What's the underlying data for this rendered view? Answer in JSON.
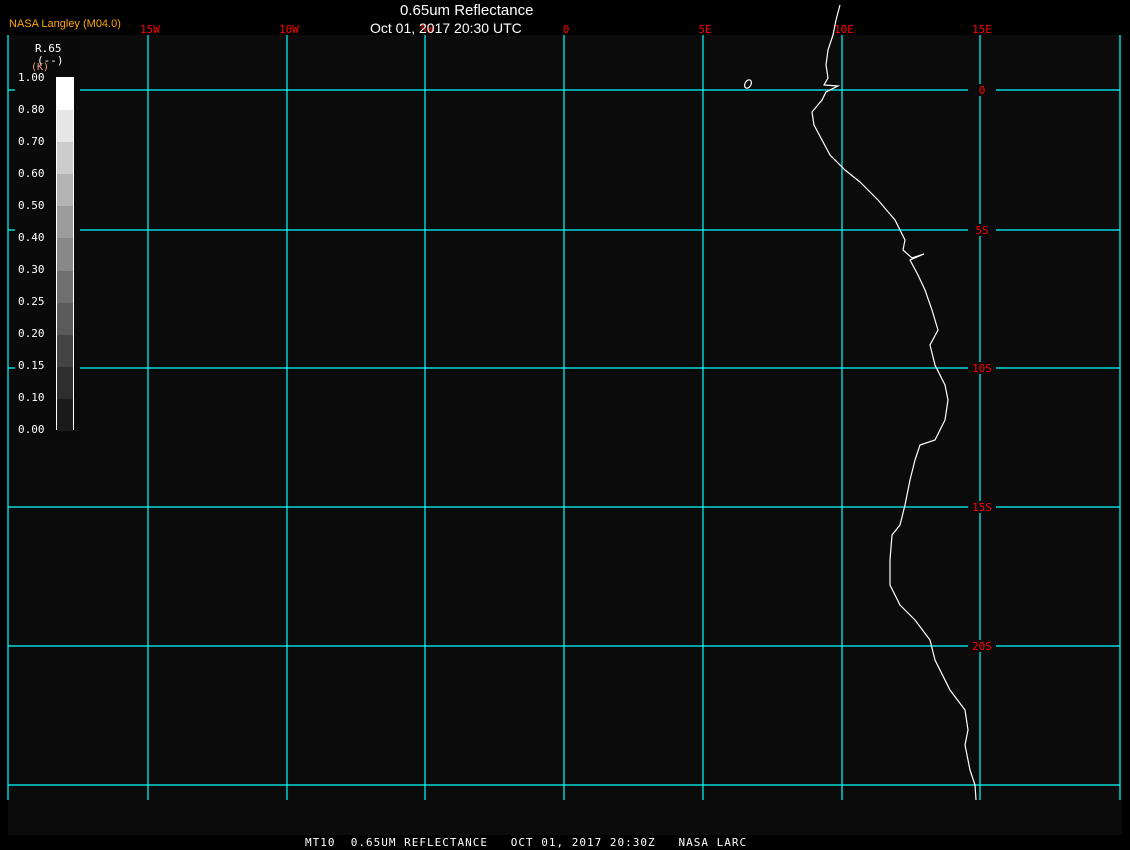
{
  "header": {
    "title": "0.65um Reflectance",
    "datetime": "Oct 01, 2017 20:30 UTC",
    "credit": "NASA Langley (M04.0)"
  },
  "footer": {
    "text": "MT10  0.65UM REFLECTANCE   OCT 01, 2017 20:30Z   NASA LARC"
  },
  "legend": {
    "variable": "R.65",
    "units": "(--)",
    "sublabel": "(K)",
    "ticks": [
      "1.00",
      "0.80",
      "0.70",
      "0.60",
      "0.50",
      "0.40",
      "0.30",
      "0.25",
      "0.20",
      "0.15",
      "0.10",
      "0.00"
    ],
    "colors": [
      "#ffffff",
      "#e6e6e6",
      "#cccccc",
      "#b4b4b4",
      "#9c9c9c",
      "#888888",
      "#707070",
      "#5a5a5a",
      "#444444",
      "#2e2e2e",
      "#1a1a1a"
    ]
  },
  "map": {
    "longitude_labels": [
      "15W",
      "10W",
      "5W",
      "0",
      "5E",
      "10E",
      "15E"
    ],
    "latitude_labels": [
      "0",
      "5S",
      "10S",
      "15S",
      "20S"
    ],
    "grid_color": "#00ffff",
    "label_color": "#ff0000",
    "coastline_color": "#ffffff",
    "background_color": "#0b0b0b"
  }
}
